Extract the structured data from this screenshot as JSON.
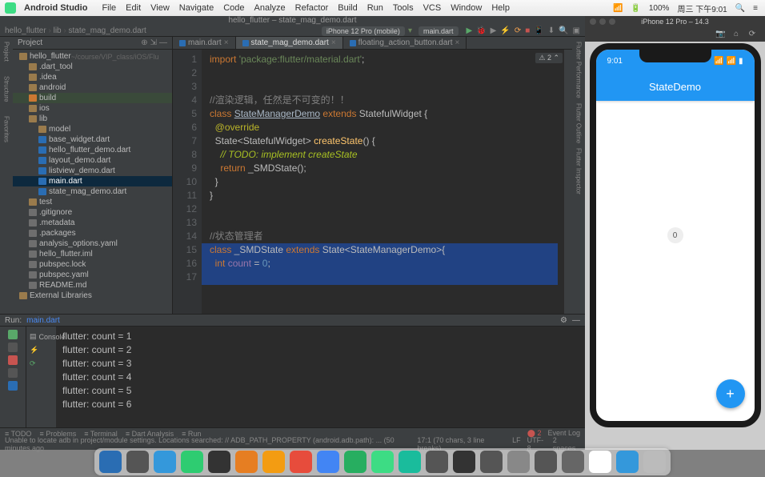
{
  "menubar": {
    "app": "Android Studio",
    "items": [
      "File",
      "Edit",
      "View",
      "Navigate",
      "Code",
      "Analyze",
      "Refactor",
      "Build",
      "Run",
      "Tools",
      "VCS",
      "Window",
      "Help"
    ],
    "status": {
      "battery": "100%",
      "datetime": "周三 下午9:01"
    }
  },
  "ide": {
    "title": "hello_flutter – state_mag_demo.dart",
    "breadcrumbs": [
      "hello_flutter",
      "lib",
      "state_mag_demo.dart"
    ],
    "device": "iPhone 12 Pro (mobile)",
    "main_file": "main.dart",
    "project_label": "Project",
    "tree": [
      {
        "d": 0,
        "ic": "folder",
        "t": "hello_flutter",
        "suffix": "  ~/course/VIP_class/iOS/Flu"
      },
      {
        "d": 1,
        "ic": "folder",
        "t": ".dart_tool"
      },
      {
        "d": 1,
        "ic": "folder",
        "t": ".idea"
      },
      {
        "d": 1,
        "ic": "folder",
        "t": "android"
      },
      {
        "d": 1,
        "ic": "build",
        "t": "build",
        "sel": false,
        "hl": true
      },
      {
        "d": 1,
        "ic": "folder",
        "t": "ios"
      },
      {
        "d": 1,
        "ic": "folder",
        "t": "lib"
      },
      {
        "d": 2,
        "ic": "folder",
        "t": "model"
      },
      {
        "d": 2,
        "ic": "dart",
        "t": "base_widget.dart"
      },
      {
        "d": 2,
        "ic": "dart",
        "t": "hello_flutter_demo.dart"
      },
      {
        "d": 2,
        "ic": "dart",
        "t": "layout_demo.dart"
      },
      {
        "d": 2,
        "ic": "dart",
        "t": "listview_demo.dart"
      },
      {
        "d": 2,
        "ic": "dart",
        "t": "main.dart",
        "sel": true
      },
      {
        "d": 2,
        "ic": "dart",
        "t": "state_mag_demo.dart"
      },
      {
        "d": 1,
        "ic": "folder",
        "t": "test"
      },
      {
        "d": 1,
        "ic": "txt",
        "t": ".gitignore"
      },
      {
        "d": 1,
        "ic": "txt",
        "t": ".metadata"
      },
      {
        "d": 1,
        "ic": "txt",
        "t": ".packages"
      },
      {
        "d": 1,
        "ic": "txt",
        "t": "analysis_options.yaml"
      },
      {
        "d": 1,
        "ic": "txt",
        "t": "hello_flutter.iml"
      },
      {
        "d": 1,
        "ic": "txt",
        "t": "pubspec.lock"
      },
      {
        "d": 1,
        "ic": "txt",
        "t": "pubspec.yaml"
      },
      {
        "d": 1,
        "ic": "txt",
        "t": "README.md"
      },
      {
        "d": 0,
        "ic": "folder",
        "t": "External Libraries"
      }
    ],
    "tabs": [
      {
        "label": "main.dart",
        "active": false
      },
      {
        "label": "state_mag_demo.dart",
        "active": true
      },
      {
        "label": "floating_action_button.dart",
        "active": false
      }
    ],
    "warn_badge": "⚠ 2 ⌃",
    "code": {
      "lines": [
        {
          "n": 1,
          "html": "<span class='kw'>import </span><span class='str'>'package:flutter/material.dart'</span>;"
        },
        {
          "n": 2,
          "html": ""
        },
        {
          "n": 3,
          "html": ""
        },
        {
          "n": 4,
          "html": "<span class='cmt'>//渲染逻辑，任然是不可变的！！</span>"
        },
        {
          "n": 5,
          "html": "<span class='kw'>class </span><span class='type'>StateManagerDemo</span> <span class='kw'>extends</span> StatefulWidget {"
        },
        {
          "n": 6,
          "html": "  <span class='ann'>@override</span>"
        },
        {
          "n": 7,
          "html": "  State&lt;StatefulWidget&gt; <span class='func'>createState</span>() {"
        },
        {
          "n": 8,
          "html": "    <span class='todo'>// TODO: implement createState</span>"
        },
        {
          "n": 9,
          "html": "    <span class='kw'>return</span> _SMDState();"
        },
        {
          "n": 10,
          "html": "  }"
        },
        {
          "n": 11,
          "html": "}"
        },
        {
          "n": 12,
          "html": ""
        },
        {
          "n": 13,
          "html": ""
        },
        {
          "n": 14,
          "html": "<span class='cmt'>//状态管理者</span>"
        },
        {
          "n": 15,
          "html": "<span class='kw'>class</span> _SMDState <span class='kw'>extends</span> State&lt;StateManagerDemo&gt;{"
        },
        {
          "n": 16,
          "html": "  <span class='kw'>int</span> <span class='field'>count</span> = <span class='num'>0</span>;"
        },
        {
          "n": 17,
          "html": ""
        }
      ]
    },
    "run": {
      "label": "Run:",
      "config": "main.dart",
      "console_tab": "Console"
    },
    "console": [
      "flutter: count = 1",
      "flutter: count = 2",
      "flutter: count = 3",
      "flutter: count = 4",
      "flutter: count = 5",
      "flutter: count = 6"
    ],
    "bottom_tabs": [
      "TODO",
      "Problems",
      "Terminal",
      "Dart Analysis",
      "Run"
    ],
    "bottom_right": [
      "Event Log"
    ],
    "status_msg": "Unable to locate adb in project/module settings. Locations searched: // ADB_PATH_PROPERTY (android.adb.path): ... (50 minutes ago",
    "status_right": [
      "17:1 (70 chars, 3 line breaks)",
      "LF",
      "UTF-8",
      "2 spaces"
    ]
  },
  "simulator": {
    "title": "iPhone 12 Pro – 14.3",
    "clock": "9:01",
    "app_title": "StateDemo",
    "counter": "0",
    "fab": "+"
  },
  "dock_colors": [
    "#2a6db3",
    "#555",
    "#3498db",
    "#2ecc71",
    "#333",
    "#e67e22",
    "#f39c12",
    "#e74c3c",
    "#4285f4",
    "#27ae60",
    "#3ddc84",
    "#1abc9c",
    "#555",
    "#333",
    "#555",
    "#888",
    "#555",
    "#666",
    "#fff",
    "#3498db",
    "#bbb"
  ]
}
